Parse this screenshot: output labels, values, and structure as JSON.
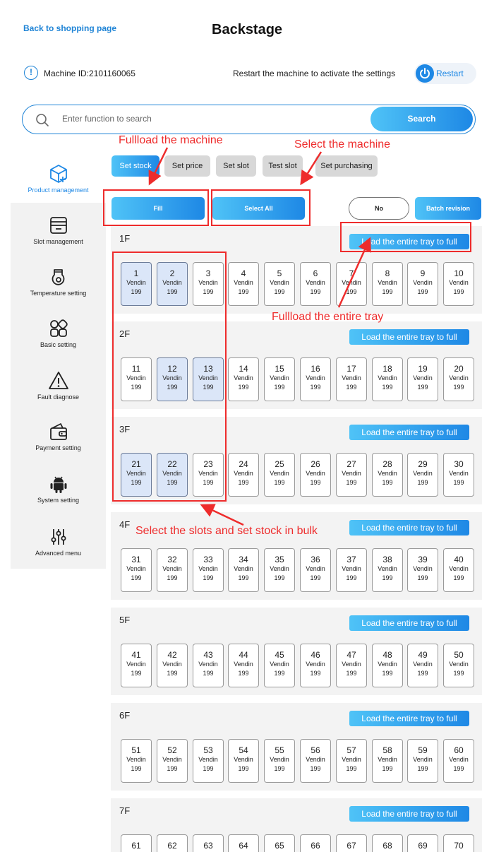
{
  "header": {
    "back_link": "Back to shopping page",
    "title": "Backstage"
  },
  "machine": {
    "id_label": "Machine ID:2101160065",
    "restart_hint": "Restart the machine to activate the settings",
    "restart_label": "Restart"
  },
  "search": {
    "placeholder": "Enter function to search",
    "button_label": "Search"
  },
  "sidebar": {
    "items": [
      {
        "label": "Product management",
        "icon": "box-plus-icon",
        "active": true
      },
      {
        "label": "Slot management",
        "icon": "slot-tray-icon"
      },
      {
        "label": "Temperature setting",
        "icon": "temperature-icon"
      },
      {
        "label": "Basic setting",
        "icon": "grid-icon"
      },
      {
        "label": "Fault diagnose",
        "icon": "warning-icon"
      },
      {
        "label": "Payment setting",
        "icon": "wallet-icon"
      },
      {
        "label": "System setting",
        "icon": "android-icon"
      },
      {
        "label": "Advanced menu",
        "icon": "sliders-icon"
      }
    ]
  },
  "tabs": [
    {
      "label": "Set stock",
      "active": true
    },
    {
      "label": "Set price"
    },
    {
      "label": "Set slot"
    },
    {
      "label": "Test slot"
    },
    {
      "label": "Set purchasing"
    }
  ],
  "actions": {
    "fill": "Fill",
    "select_all": "Select All",
    "no": "No",
    "batch_revision": "Batch revision"
  },
  "load_label": "Load the entire tray to full",
  "trays": [
    {
      "name": "1F",
      "slots": [
        {
          "num": "1",
          "name": "Vendin",
          "stock": "199",
          "selected": true
        },
        {
          "num": "2",
          "name": "Vendin",
          "stock": "199",
          "selected": true
        },
        {
          "num": "3",
          "name": "Vendin",
          "stock": "199"
        },
        {
          "num": "4",
          "name": "Vendin",
          "stock": "199"
        },
        {
          "num": "5",
          "name": "Vendin",
          "stock": "199"
        },
        {
          "num": "6",
          "name": "Vendin",
          "stock": "199"
        },
        {
          "num": "7",
          "name": "Vendin",
          "stock": "199"
        },
        {
          "num": "8",
          "name": "Vendin",
          "stock": "199"
        },
        {
          "num": "9",
          "name": "Vendin",
          "stock": "199"
        },
        {
          "num": "10",
          "name": "Vendin",
          "stock": "199"
        }
      ]
    },
    {
      "name": "2F",
      "slots": [
        {
          "num": "11",
          "name": "Vendin",
          "stock": "199"
        },
        {
          "num": "12",
          "name": "Vendin",
          "stock": "199",
          "selected": true
        },
        {
          "num": "13",
          "name": "Vendin",
          "stock": "199",
          "selected": true
        },
        {
          "num": "14",
          "name": "Vendin",
          "stock": "199"
        },
        {
          "num": "15",
          "name": "Vendin",
          "stock": "199"
        },
        {
          "num": "16",
          "name": "Vendin",
          "stock": "199"
        },
        {
          "num": "17",
          "name": "Vendin",
          "stock": "199"
        },
        {
          "num": "18",
          "name": "Vendin",
          "stock": "199"
        },
        {
          "num": "19",
          "name": "Vendin",
          "stock": "199"
        },
        {
          "num": "20",
          "name": "Vendin",
          "stock": "199"
        }
      ]
    },
    {
      "name": "3F",
      "slots": [
        {
          "num": "21",
          "name": "Vendin",
          "stock": "199",
          "selected": true
        },
        {
          "num": "22",
          "name": "Vendin",
          "stock": "199",
          "selected": true
        },
        {
          "num": "23",
          "name": "Vendin",
          "stock": "199"
        },
        {
          "num": "24",
          "name": "Vendin",
          "stock": "199"
        },
        {
          "num": "25",
          "name": "Vendin",
          "stock": "199"
        },
        {
          "num": "26",
          "name": "Vendin",
          "stock": "199"
        },
        {
          "num": "27",
          "name": "Vendin",
          "stock": "199"
        },
        {
          "num": "28",
          "name": "Vendin",
          "stock": "199"
        },
        {
          "num": "29",
          "name": "Vendin",
          "stock": "199"
        },
        {
          "num": "30",
          "name": "Vendin",
          "stock": "199"
        }
      ]
    },
    {
      "name": "4F",
      "slots": [
        {
          "num": "31",
          "name": "Vendin",
          "stock": "199"
        },
        {
          "num": "32",
          "name": "Vendin",
          "stock": "199"
        },
        {
          "num": "33",
          "name": "Vendin",
          "stock": "199"
        },
        {
          "num": "34",
          "name": "Vendin",
          "stock": "199"
        },
        {
          "num": "35",
          "name": "Vendin",
          "stock": "199"
        },
        {
          "num": "36",
          "name": "Vendin",
          "stock": "199"
        },
        {
          "num": "37",
          "name": "Vendin",
          "stock": "199"
        },
        {
          "num": "38",
          "name": "Vendin",
          "stock": "199"
        },
        {
          "num": "39",
          "name": "Vendin",
          "stock": "199"
        },
        {
          "num": "40",
          "name": "Vendin",
          "stock": "199"
        }
      ]
    },
    {
      "name": "5F",
      "slots": [
        {
          "num": "41",
          "name": "Vendin",
          "stock": "199"
        },
        {
          "num": "42",
          "name": "Vendin",
          "stock": "199"
        },
        {
          "num": "43",
          "name": "Vendin",
          "stock": "199"
        },
        {
          "num": "44",
          "name": "Vendin",
          "stock": "199"
        },
        {
          "num": "45",
          "name": "Vendin",
          "stock": "199"
        },
        {
          "num": "46",
          "name": "Vendin",
          "stock": "199"
        },
        {
          "num": "47",
          "name": "Vendin",
          "stock": "199"
        },
        {
          "num": "48",
          "name": "Vendin",
          "stock": "199"
        },
        {
          "num": "49",
          "name": "Vendin",
          "stock": "199"
        },
        {
          "num": "50",
          "name": "Vendin",
          "stock": "199"
        }
      ]
    },
    {
      "name": "6F",
      "slots": [
        {
          "num": "51",
          "name": "Vendin",
          "stock": "199"
        },
        {
          "num": "52",
          "name": "Vendin",
          "stock": "199"
        },
        {
          "num": "53",
          "name": "Vendin",
          "stock": "199"
        },
        {
          "num": "54",
          "name": "Vendin",
          "stock": "199"
        },
        {
          "num": "55",
          "name": "Vendin",
          "stock": "199"
        },
        {
          "num": "56",
          "name": "Vendin",
          "stock": "199"
        },
        {
          "num": "57",
          "name": "Vendin",
          "stock": "199"
        },
        {
          "num": "58",
          "name": "Vendin",
          "stock": "199"
        },
        {
          "num": "59",
          "name": "Vendin",
          "stock": "199"
        },
        {
          "num": "60",
          "name": "Vendin",
          "stock": "199"
        }
      ]
    },
    {
      "name": "7F",
      "slots": [
        {
          "num": "61"
        },
        {
          "num": "62"
        },
        {
          "num": "63"
        },
        {
          "num": "64"
        },
        {
          "num": "65"
        },
        {
          "num": "66"
        },
        {
          "num": "67"
        },
        {
          "num": "68"
        },
        {
          "num": "69"
        },
        {
          "num": "70"
        }
      ]
    }
  ],
  "annotations": {
    "fullload_machine": "Fullload the machine",
    "select_machine": "Select the machine",
    "fullload_tray": "Fullload the entire tray",
    "select_slots": "Select the slots and set stock in bulk"
  },
  "colors": {
    "accent": "#1e88e5",
    "accent_light": "#4fc3f7",
    "annotation": "#ee2c2c",
    "selected_slot": "#dbe6f8"
  }
}
